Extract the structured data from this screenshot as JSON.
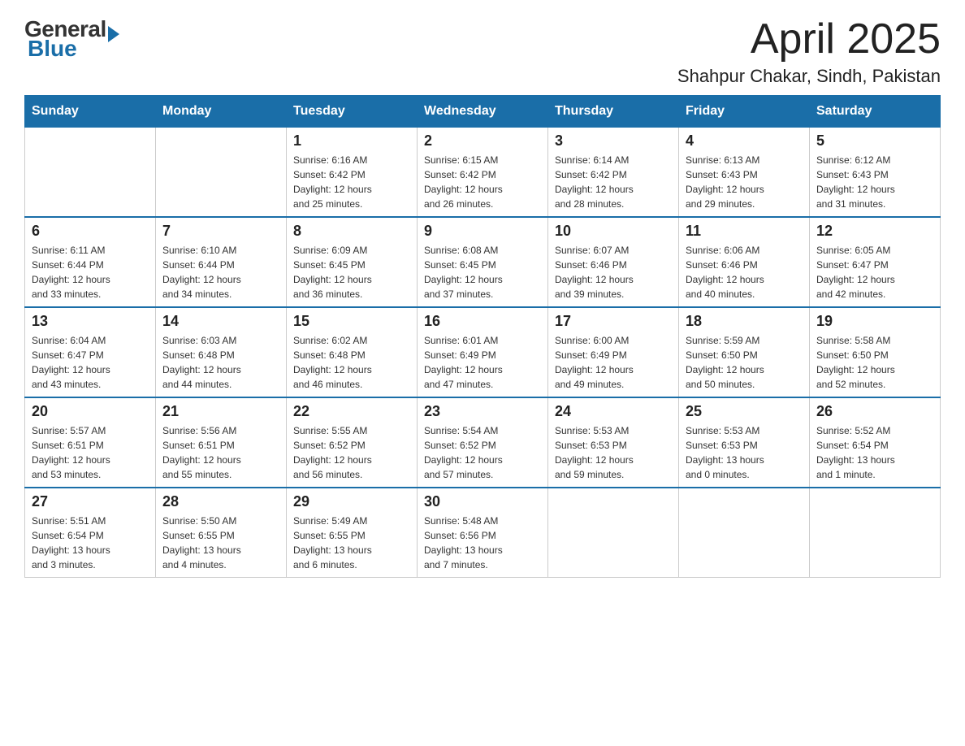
{
  "header": {
    "logo_general": "General",
    "logo_blue": "Blue",
    "month_title": "April 2025",
    "location": "Shahpur Chakar, Sindh, Pakistan"
  },
  "weekdays": [
    "Sunday",
    "Monday",
    "Tuesday",
    "Wednesday",
    "Thursday",
    "Friday",
    "Saturday"
  ],
  "weeks": [
    [
      {
        "day": "",
        "info": ""
      },
      {
        "day": "",
        "info": ""
      },
      {
        "day": "1",
        "info": "Sunrise: 6:16 AM\nSunset: 6:42 PM\nDaylight: 12 hours\nand 25 minutes."
      },
      {
        "day": "2",
        "info": "Sunrise: 6:15 AM\nSunset: 6:42 PM\nDaylight: 12 hours\nand 26 minutes."
      },
      {
        "day": "3",
        "info": "Sunrise: 6:14 AM\nSunset: 6:42 PM\nDaylight: 12 hours\nand 28 minutes."
      },
      {
        "day": "4",
        "info": "Sunrise: 6:13 AM\nSunset: 6:43 PM\nDaylight: 12 hours\nand 29 minutes."
      },
      {
        "day": "5",
        "info": "Sunrise: 6:12 AM\nSunset: 6:43 PM\nDaylight: 12 hours\nand 31 minutes."
      }
    ],
    [
      {
        "day": "6",
        "info": "Sunrise: 6:11 AM\nSunset: 6:44 PM\nDaylight: 12 hours\nand 33 minutes."
      },
      {
        "day": "7",
        "info": "Sunrise: 6:10 AM\nSunset: 6:44 PM\nDaylight: 12 hours\nand 34 minutes."
      },
      {
        "day": "8",
        "info": "Sunrise: 6:09 AM\nSunset: 6:45 PM\nDaylight: 12 hours\nand 36 minutes."
      },
      {
        "day": "9",
        "info": "Sunrise: 6:08 AM\nSunset: 6:45 PM\nDaylight: 12 hours\nand 37 minutes."
      },
      {
        "day": "10",
        "info": "Sunrise: 6:07 AM\nSunset: 6:46 PM\nDaylight: 12 hours\nand 39 minutes."
      },
      {
        "day": "11",
        "info": "Sunrise: 6:06 AM\nSunset: 6:46 PM\nDaylight: 12 hours\nand 40 minutes."
      },
      {
        "day": "12",
        "info": "Sunrise: 6:05 AM\nSunset: 6:47 PM\nDaylight: 12 hours\nand 42 minutes."
      }
    ],
    [
      {
        "day": "13",
        "info": "Sunrise: 6:04 AM\nSunset: 6:47 PM\nDaylight: 12 hours\nand 43 minutes."
      },
      {
        "day": "14",
        "info": "Sunrise: 6:03 AM\nSunset: 6:48 PM\nDaylight: 12 hours\nand 44 minutes."
      },
      {
        "day": "15",
        "info": "Sunrise: 6:02 AM\nSunset: 6:48 PM\nDaylight: 12 hours\nand 46 minutes."
      },
      {
        "day": "16",
        "info": "Sunrise: 6:01 AM\nSunset: 6:49 PM\nDaylight: 12 hours\nand 47 minutes."
      },
      {
        "day": "17",
        "info": "Sunrise: 6:00 AM\nSunset: 6:49 PM\nDaylight: 12 hours\nand 49 minutes."
      },
      {
        "day": "18",
        "info": "Sunrise: 5:59 AM\nSunset: 6:50 PM\nDaylight: 12 hours\nand 50 minutes."
      },
      {
        "day": "19",
        "info": "Sunrise: 5:58 AM\nSunset: 6:50 PM\nDaylight: 12 hours\nand 52 minutes."
      }
    ],
    [
      {
        "day": "20",
        "info": "Sunrise: 5:57 AM\nSunset: 6:51 PM\nDaylight: 12 hours\nand 53 minutes."
      },
      {
        "day": "21",
        "info": "Sunrise: 5:56 AM\nSunset: 6:51 PM\nDaylight: 12 hours\nand 55 minutes."
      },
      {
        "day": "22",
        "info": "Sunrise: 5:55 AM\nSunset: 6:52 PM\nDaylight: 12 hours\nand 56 minutes."
      },
      {
        "day": "23",
        "info": "Sunrise: 5:54 AM\nSunset: 6:52 PM\nDaylight: 12 hours\nand 57 minutes."
      },
      {
        "day": "24",
        "info": "Sunrise: 5:53 AM\nSunset: 6:53 PM\nDaylight: 12 hours\nand 59 minutes."
      },
      {
        "day": "25",
        "info": "Sunrise: 5:53 AM\nSunset: 6:53 PM\nDaylight: 13 hours\nand 0 minutes."
      },
      {
        "day": "26",
        "info": "Sunrise: 5:52 AM\nSunset: 6:54 PM\nDaylight: 13 hours\nand 1 minute."
      }
    ],
    [
      {
        "day": "27",
        "info": "Sunrise: 5:51 AM\nSunset: 6:54 PM\nDaylight: 13 hours\nand 3 minutes."
      },
      {
        "day": "28",
        "info": "Sunrise: 5:50 AM\nSunset: 6:55 PM\nDaylight: 13 hours\nand 4 minutes."
      },
      {
        "day": "29",
        "info": "Sunrise: 5:49 AM\nSunset: 6:55 PM\nDaylight: 13 hours\nand 6 minutes."
      },
      {
        "day": "30",
        "info": "Sunrise: 5:48 AM\nSunset: 6:56 PM\nDaylight: 13 hours\nand 7 minutes."
      },
      {
        "day": "",
        "info": ""
      },
      {
        "day": "",
        "info": ""
      },
      {
        "day": "",
        "info": ""
      }
    ]
  ]
}
